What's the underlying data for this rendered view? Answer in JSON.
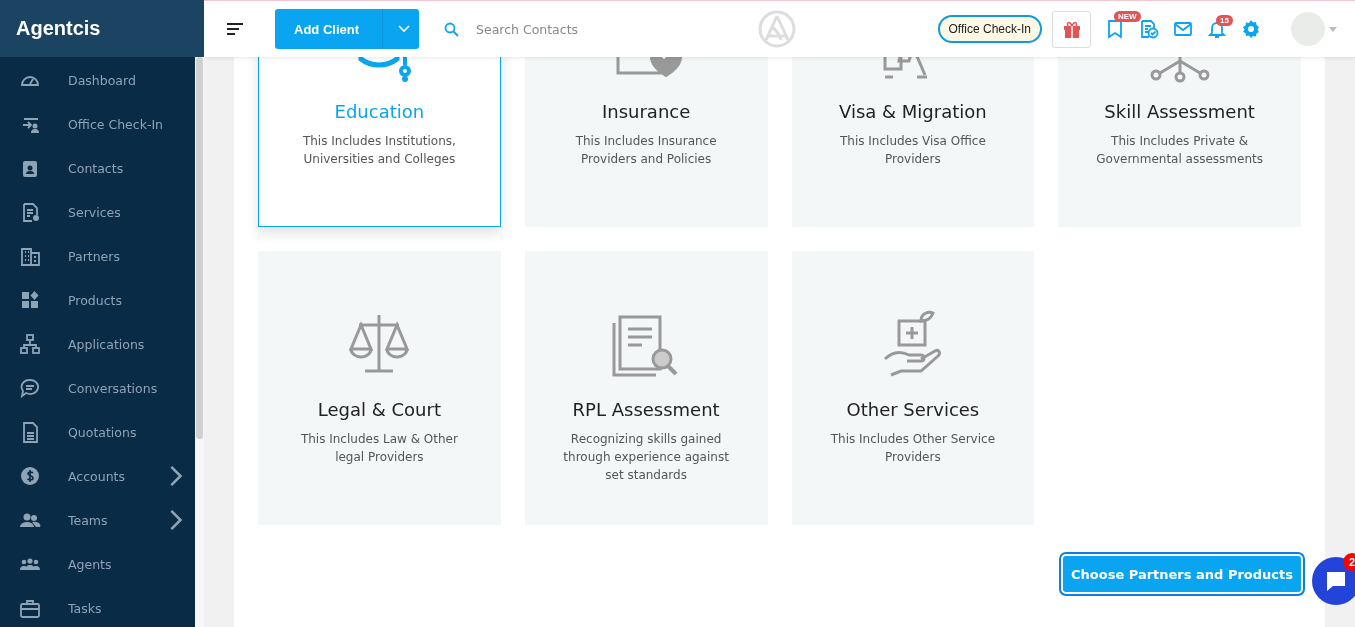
{
  "sidebar": {
    "brand": "Agentcis",
    "items": [
      {
        "label": "Dashboard",
        "submenu": false
      },
      {
        "label": "Office Check-In",
        "submenu": false
      },
      {
        "label": "Contacts",
        "submenu": false
      },
      {
        "label": "Services",
        "submenu": false
      },
      {
        "label": "Partners",
        "submenu": false
      },
      {
        "label": "Products",
        "submenu": false
      },
      {
        "label": "Applications",
        "submenu": false
      },
      {
        "label": "Conversations",
        "submenu": false
      },
      {
        "label": "Quotations",
        "submenu": false
      },
      {
        "label": "Accounts",
        "submenu": true
      },
      {
        "label": "Teams",
        "submenu": true
      },
      {
        "label": "Agents",
        "submenu": false
      },
      {
        "label": "Tasks",
        "submenu": false
      }
    ]
  },
  "header": {
    "add_button": "Add Client",
    "search": {
      "placeholder": "Search Contacts"
    },
    "checkin_button": "Office Check-In",
    "new_badge": "NEW",
    "notification_count": "15"
  },
  "categories": [
    {
      "title": "Education",
      "description": "This Includes Institutions, Universities and Colleges",
      "selected": true
    },
    {
      "title": "Insurance",
      "description": "This Includes Insurance Providers and Policies",
      "selected": false
    },
    {
      "title": "Visa & Migration",
      "description": "This Includes Visa Office Providers",
      "selected": false
    },
    {
      "title": "Skill Assessment",
      "description": "This Includes Private & Governmental assessments",
      "selected": false
    },
    {
      "title": "Legal & Court",
      "description": "This Includes Law & Other legal Providers",
      "selected": false
    },
    {
      "title": "RPL Assessment",
      "description": "Recognizing skills gained through experience against set standards",
      "selected": false
    },
    {
      "title": "Other Services",
      "description": "This Includes Other Service Providers",
      "selected": false
    }
  ],
  "primary_button": "Choose Partners and Products",
  "chat": {
    "unread": "2"
  }
}
